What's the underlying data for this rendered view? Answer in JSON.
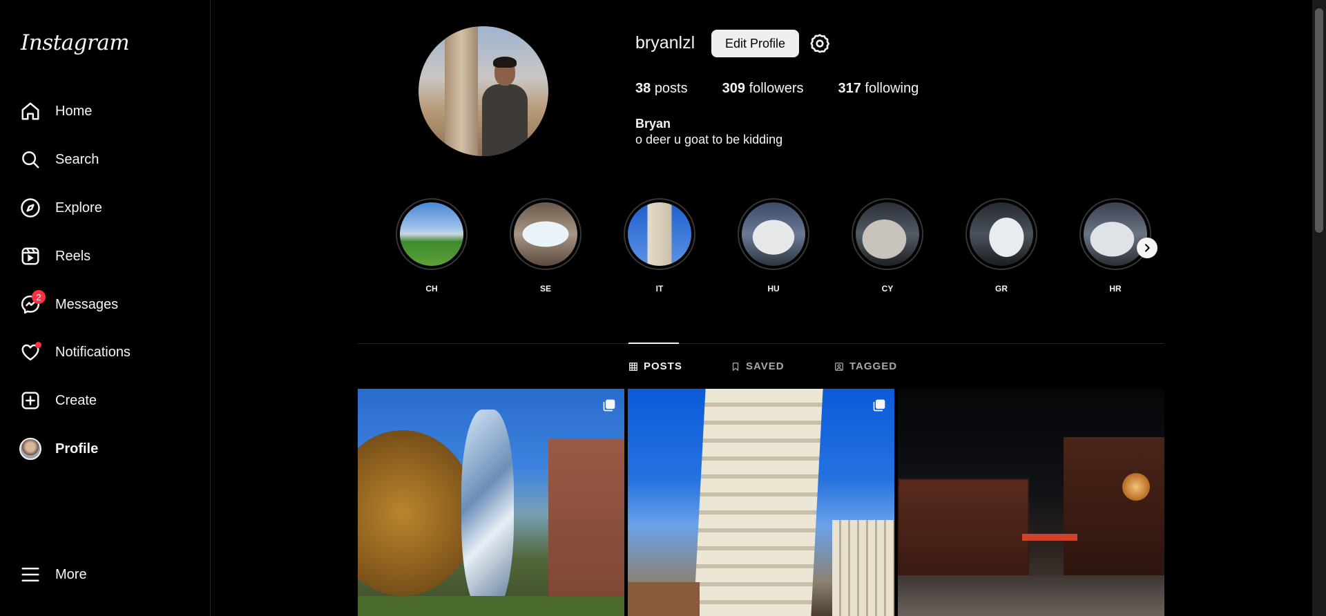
{
  "app": {
    "logo": "Instagram"
  },
  "sidebar": {
    "items": [
      {
        "label": "Home",
        "icon": "home-icon"
      },
      {
        "label": "Search",
        "icon": "search-icon"
      },
      {
        "label": "Explore",
        "icon": "compass-icon"
      },
      {
        "label": "Reels",
        "icon": "reels-icon"
      },
      {
        "label": "Messages",
        "icon": "messenger-icon",
        "badge": "2"
      },
      {
        "label": "Notifications",
        "icon": "heart-icon"
      },
      {
        "label": "Create",
        "icon": "plus-square-icon"
      },
      {
        "label": "Profile",
        "icon": "avatar"
      }
    ],
    "more": "More"
  },
  "profile": {
    "username": "bryanlzl",
    "edit_label": "Edit Profile",
    "posts_count": "38",
    "posts_label": "posts",
    "followers_count": "309",
    "followers_label": "followers",
    "following_count": "317",
    "following_label": "following",
    "full_name": "Bryan",
    "bio": "o deer u goat to be kidding"
  },
  "highlights": [
    {
      "label": "CH"
    },
    {
      "label": "SE"
    },
    {
      "label": "IT"
    },
    {
      "label": "HU"
    },
    {
      "label": "CY"
    },
    {
      "label": "GR"
    },
    {
      "label": "HR"
    }
  ],
  "tabs": {
    "posts": "POSTS",
    "saved": "SAVED",
    "tagged": "TAGGED"
  },
  "colors": {
    "background": "#000000",
    "text": "#f5f5f5",
    "badge": "#ff3040",
    "divider": "#262626"
  }
}
